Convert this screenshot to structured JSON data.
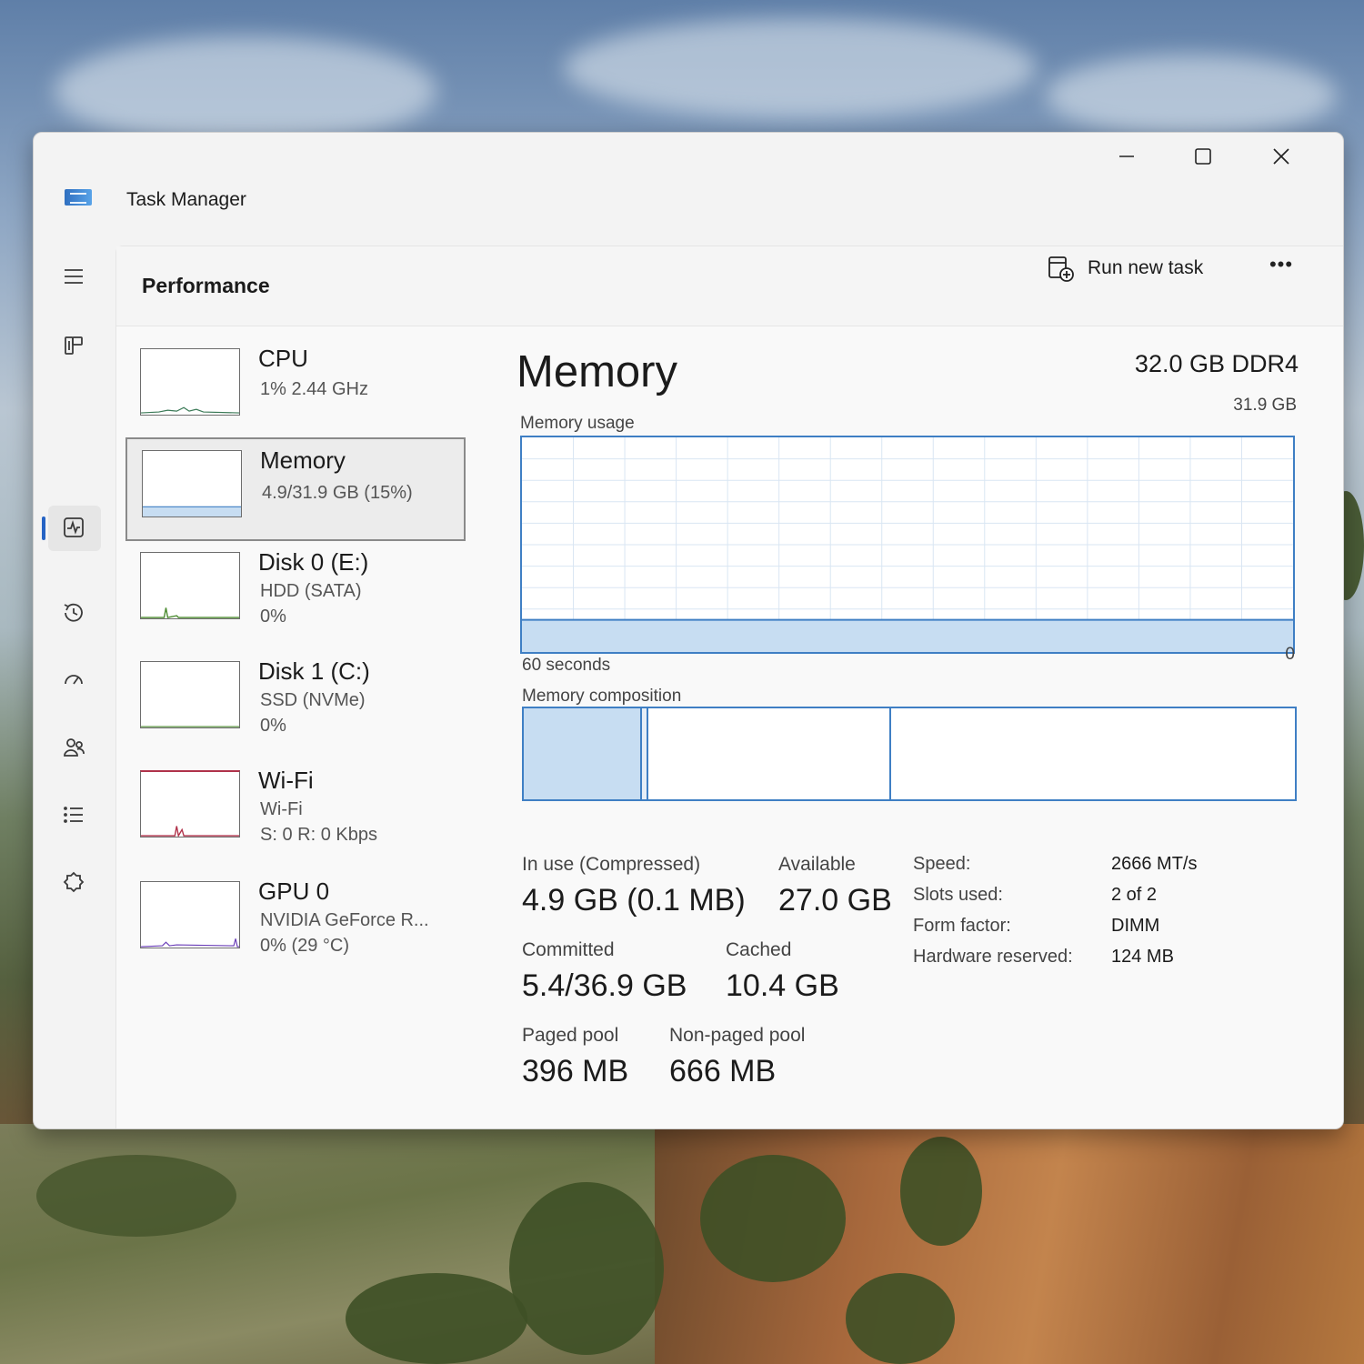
{
  "window": {
    "title": "Task Manager",
    "controls": {
      "minimize": "—",
      "maximize": "☐",
      "close": "✕"
    }
  },
  "nav": {
    "items": [
      {
        "icon": "hamburger-icon"
      },
      {
        "icon": "processes-icon"
      },
      {
        "icon": "performance-icon",
        "active": true
      },
      {
        "icon": "app-history-icon"
      },
      {
        "icon": "startup-apps-icon"
      },
      {
        "icon": "users-icon"
      },
      {
        "icon": "details-icon"
      },
      {
        "icon": "services-icon"
      },
      {
        "icon": "settings-icon"
      }
    ]
  },
  "header": {
    "title": "Performance",
    "run_new_task": "Run new task",
    "more": "•••"
  },
  "devices": [
    {
      "name": "CPU",
      "line1": "1%  2.44 GHz",
      "line2": "",
      "selected": false
    },
    {
      "name": "Memory",
      "line1": "4.9/31.9 GB (15%)",
      "line2": "",
      "selected": true
    },
    {
      "name": "Disk 0 (E:)",
      "line1": "HDD (SATA)",
      "line2": "0%",
      "selected": false
    },
    {
      "name": "Disk 1 (C:)",
      "line1": "SSD (NVMe)",
      "line2": "0%",
      "selected": false
    },
    {
      "name": "Wi-Fi",
      "line1": "Wi-Fi",
      "line2": "S: 0 R: 0 Kbps",
      "selected": false
    },
    {
      "name": "GPU 0",
      "line1": "NVIDIA GeForce R...",
      "line2": "0%  (29 °C)",
      "selected": false
    }
  ],
  "memory": {
    "title": "Memory",
    "spec": "32.0 GB DDR4",
    "usage_label": "Memory usage",
    "usage_max": "31.9 GB",
    "time_label": "60 seconds",
    "zero_label": "0",
    "usage_fraction": 0.15,
    "composition_label": "Memory composition",
    "composition_fractions": {
      "in_use": 0.153,
      "modified": 0.009,
      "standby": 0.314,
      "free": 0.524
    },
    "stats": {
      "in_use_label": "In use (Compressed)",
      "in_use_value": "4.9 GB (0.1 MB)",
      "available_label": "Available",
      "available_value": "27.0 GB",
      "committed_label": "Committed",
      "committed_value": "5.4/36.9 GB",
      "cached_label": "Cached",
      "cached_value": "10.4 GB",
      "paged_label": "Paged pool",
      "paged_value": "396 MB",
      "nonpaged_label": "Non-paged pool",
      "nonpaged_value": "666 MB"
    },
    "specs": [
      {
        "key": "Speed:",
        "value": "2666 MT/s"
      },
      {
        "key": "Slots used:",
        "value": "2 of 2"
      },
      {
        "key": "Form factor:",
        "value": "DIMM"
      },
      {
        "key": "Hardware reserved:",
        "value": "124 MB"
      }
    ]
  },
  "colors": {
    "accent": "#3f7fc4",
    "fill": "#c7ddf2",
    "nav_active": "#2563c4"
  }
}
